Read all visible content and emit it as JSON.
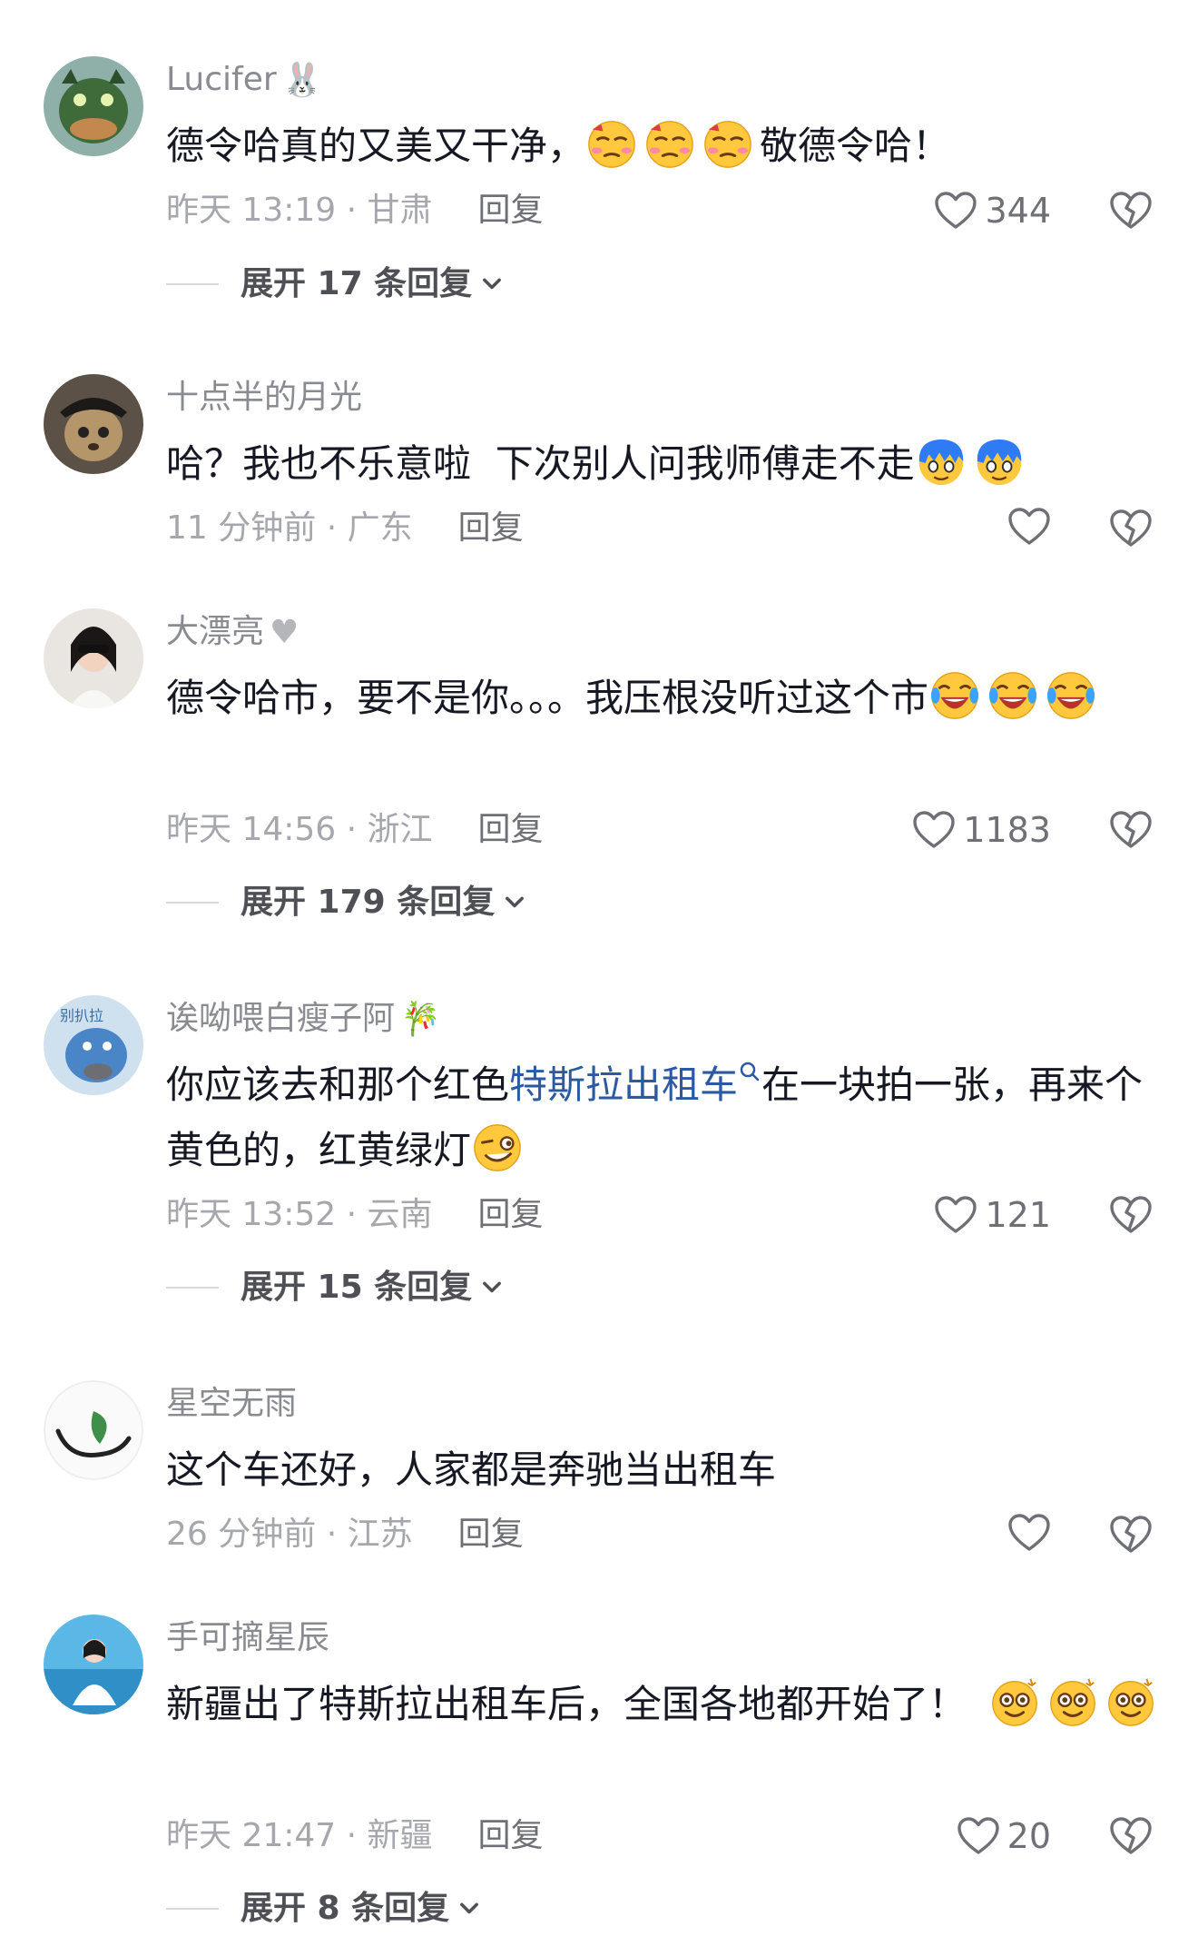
{
  "comments": [
    {
      "username": "Lucifer",
      "text_before": "德令哈真的又美又干净，",
      "text_after": "敬德令哈！",
      "time": "昨天 13:19 · 甘肃",
      "reply_label": "回复",
      "likes": "344",
      "expand": "展开 17 条回复"
    },
    {
      "username": "十点半的月光",
      "text_before": "哈？我也不乐意啦  下次别人问我师傅走不走",
      "time": "11 分钟前 · 广东",
      "reply_label": "回复",
      "likes": ""
    },
    {
      "username": "大漂亮",
      "text_before": "德令哈市，要不是你。。。我压根没听过这个市",
      "time": "昨天 14:56 · 浙江",
      "reply_label": "回复",
      "likes": "1183",
      "expand": "展开 179 条回复"
    },
    {
      "username": "诶呦喂白瘦子阿",
      "text_before": "你应该去和那个红色",
      "keyword": "特斯拉出租车",
      "text_after": "在一块拍一张，再来个黄色的，红黄绿灯",
      "time": "昨天 13:52 · 云南",
      "reply_label": "回复",
      "likes": "121",
      "expand": "展开 15 条回复"
    },
    {
      "username": "星空无雨",
      "text_before": "这个车还好，人家都是奔驰当出租车",
      "time": "26 分钟前 · 江苏",
      "reply_label": "回复",
      "likes": ""
    },
    {
      "username": "手可摘星辰",
      "text_before": "新疆出了特斯拉出租车后，全国各地都开始了！",
      "time": "昨天 21:47 · 新疆",
      "reply_label": "回复",
      "likes": "20",
      "expand": "展开 8 条回复"
    }
  ],
  "icons": {
    "like": "heart-outline-icon",
    "dislike": "broken-heart-icon",
    "expand": "chevron-down-icon",
    "search": "search-icon"
  },
  "colors": {
    "keyword": "#2b5aa3",
    "meta": "#a6a7ac",
    "username": "#8a8b91"
  }
}
